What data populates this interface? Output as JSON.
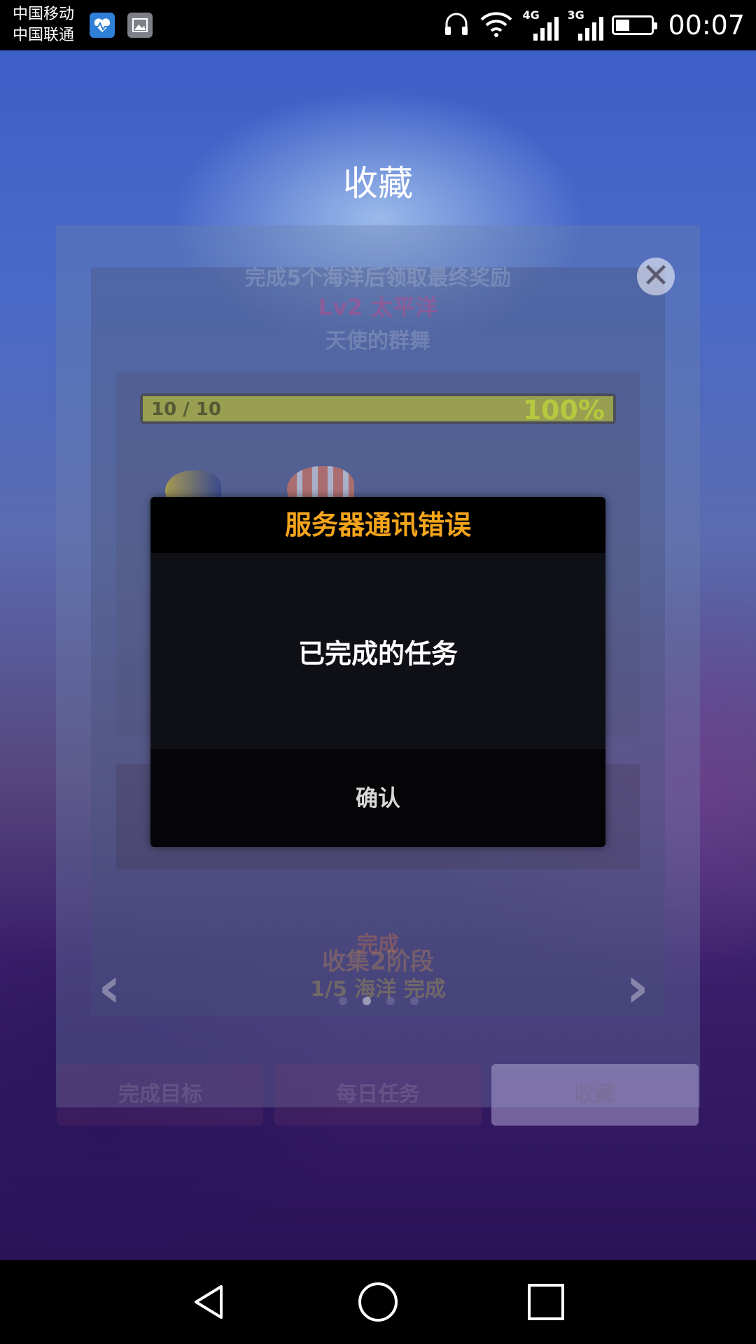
{
  "status_bar": {
    "carrier_1": "中国移动",
    "carrier_2": "中国联通",
    "net_1": "4G",
    "net_2": "3G",
    "time": "00:07",
    "battery_level": 0.45,
    "icons": [
      "health-app-icon",
      "gallery-icon",
      "headphones-icon",
      "wifi-icon",
      "signal-icon",
      "battery-icon"
    ]
  },
  "header": {
    "title": "收藏"
  },
  "collection": {
    "subtitle": "完成5个海洋后领取最终奖励",
    "level": "Lv2 太平洋",
    "tagline": "天使的群舞",
    "progress_count": "10 / 10",
    "progress_percent": "100%",
    "progress_value": 1.0,
    "done_label": "完成",
    "collect_stage": "收集2阶段",
    "ocean_status": "1/5 海洋 完成",
    "page_index": 1,
    "page_count": 4
  },
  "tabs": [
    {
      "label": "完成目标"
    },
    {
      "label": "每日任务"
    },
    {
      "label": "收藏"
    }
  ],
  "dialog": {
    "title": "服务器通讯错误",
    "message": "已完成的任务",
    "confirm": "确认"
  },
  "colors": {
    "dialog_title": "#f4a51c",
    "dialog_bg": "#0f0f16",
    "background_top": "#3d5fc8",
    "background_bottom": "#2b1358"
  }
}
